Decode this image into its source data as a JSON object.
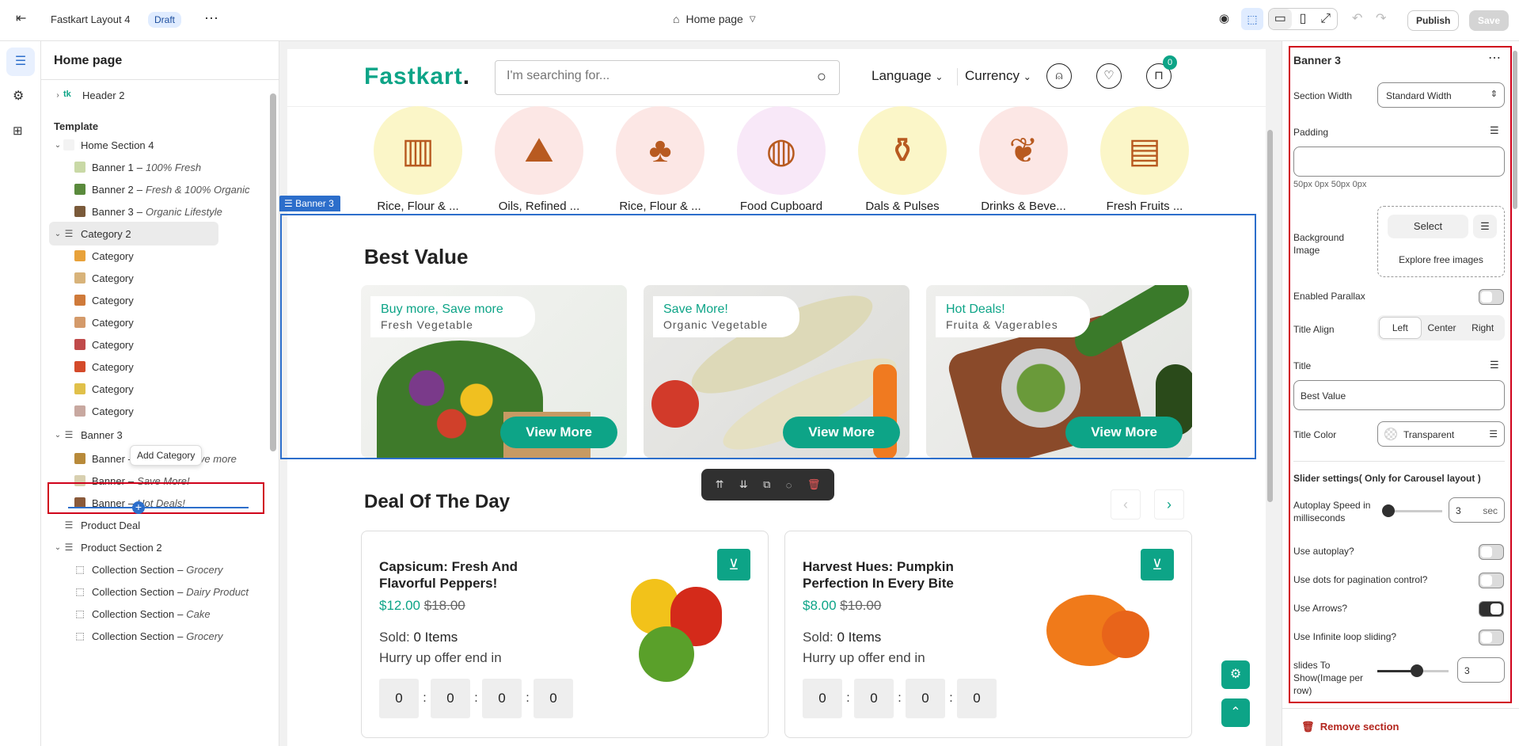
{
  "topbar": {
    "exit_icon": "exit-icon",
    "store_name": "Fastkart Layout 4",
    "badge": "Draft",
    "more_icon": "ellipsis-icon",
    "page_selector": "Home page",
    "publish": "Publish",
    "save": "Save"
  },
  "left_panel": {
    "title": "Home page",
    "header_item": "Header 2",
    "template_label": "Template",
    "tooltip": "Add Category",
    "items": [
      {
        "label": "Home Section 4",
        "sub": ""
      },
      {
        "label": "Banner 1",
        "sub": "100% Fresh"
      },
      {
        "label": "Banner 2",
        "sub": "Fresh & 100% Organic"
      },
      {
        "label": "Banner 3",
        "sub": "Organic Lifestyle"
      },
      {
        "label": "Category 2",
        "sub": ""
      },
      {
        "label": "Category",
        "sub": ""
      },
      {
        "label": "Category",
        "sub": ""
      },
      {
        "label": "Category",
        "sub": ""
      },
      {
        "label": "Category",
        "sub": ""
      },
      {
        "label": "Category",
        "sub": ""
      },
      {
        "label": "Category",
        "sub": ""
      },
      {
        "label": "Category",
        "sub": ""
      },
      {
        "label": "Category",
        "sub": ""
      },
      {
        "label": "Banner 3",
        "sub": ""
      },
      {
        "label": "Banner",
        "sub": "Buy more, Save more"
      },
      {
        "label": "Banner",
        "sub": "Save More!"
      },
      {
        "label": "Banner",
        "sub": "Hot Deals!"
      },
      {
        "label": "Product Deal",
        "sub": ""
      },
      {
        "label": "Product Section 2",
        "sub": ""
      },
      {
        "label": "Collection Section",
        "sub": "Grocery"
      },
      {
        "label": "Collection Section",
        "sub": "Dairy Product"
      },
      {
        "label": "Collection Section",
        "sub": "Cake"
      },
      {
        "label": "Collection Section",
        "sub": "Grocery"
      }
    ],
    "dash": "–"
  },
  "site": {
    "logo": "Fastkart",
    "logo_dot": ".",
    "search_placeholder": "I'm searching for...",
    "language": "Language",
    "currency": "Currency",
    "cart_count": "0",
    "categories": [
      "Rice, Flour & ...",
      "Oils, Refined ...",
      "Rice, Flour & ...",
      "Food Cupboard",
      "Dals & Pulses",
      "Drinks & Beve...",
      "Fresh Fruits ..."
    ],
    "section_badge": "Banner 3",
    "best_value_title": "Best Value",
    "banners": [
      {
        "title": "Buy more, Save more",
        "subtitle": "Fresh Vegetable",
        "button": "View More"
      },
      {
        "title": "Save More!",
        "subtitle": "Organic Vegetable",
        "button": "View More"
      },
      {
        "title": "Hot Deals!",
        "subtitle": "Fruita & Vagerables",
        "button": "View More"
      }
    ],
    "deal_title": "Deal Of The Day",
    "deals": [
      {
        "name": "Capsicum: Fresh And Flavorful Peppers!",
        "price": "$12.00",
        "old_price": "$18.00",
        "sold_label": "Sold:",
        "sold_value": "0 Items",
        "hurry": "Hurry up offer end in",
        "timer": [
          "0",
          "0",
          "0",
          "0"
        ]
      },
      {
        "name": "Harvest Hues: Pumpkin Perfection In Every Bite",
        "price": "$8.00",
        "old_price": "$10.00",
        "sold_label": "Sold:",
        "sold_value": "0 Items",
        "hurry": "Hurry up offer end in",
        "timer": [
          "0",
          "0",
          "0",
          "0"
        ]
      }
    ],
    "colon": ":"
  },
  "right_panel": {
    "title": "Banner 3",
    "section_width_label": "Section Width",
    "section_width_value": "Standard Width",
    "padding_label": "Padding",
    "padding_hint": "50px 0px 50px 0px",
    "bg_image_label": "Background Image",
    "select_btn": "Select",
    "explore": "Explore free images",
    "parallax_label": "Enabled Parallax",
    "title_align_label": "Title Align",
    "align_options": [
      "Left",
      "Center",
      "Right"
    ],
    "title_label": "Title",
    "title_value": "Best Value",
    "title_color_label": "Title Color",
    "title_color_value": "Transparent",
    "slider_heading": "Slider settings( Only for Carousel layout )",
    "autoplay_speed_label": "Autoplay Speed in milliseconds",
    "autoplay_speed_value": "3",
    "sec": "sec",
    "autoplay_label": "Use autoplay?",
    "dots_label": "Use dots for pagination control?",
    "arrows_label": "Use Arrows?",
    "loop_label": "Use Infinite loop sliding?",
    "slides_label": "slides To Show(Image per row)",
    "slides_value": "3",
    "remove": "Remove section"
  },
  "colors": {
    "accent": "#0da487",
    "highlight": "#d0021b",
    "selection": "#2c6ecb"
  }
}
